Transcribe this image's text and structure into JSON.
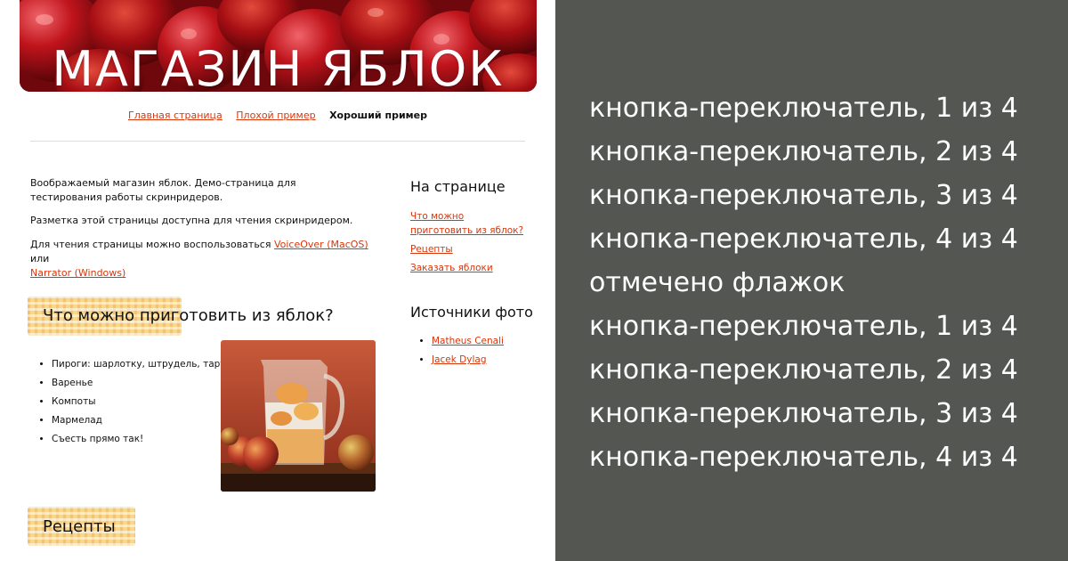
{
  "hero": {
    "title": "МАГАЗИН ЯБЛОК"
  },
  "nav": {
    "home": "Главная страница",
    "bad": "Плохой пример",
    "good": "Хороший пример"
  },
  "intro": {
    "p1": "Воображаемый магазин яблок. Демо-страница для тестирования работы скринридеров.",
    "p2": "Разметка этой страницы доступна для чтения скринридером.",
    "p3_before": "Для чтения страницы можно воспользоваться ",
    "voiceover": "VoiceOver (MacOS)",
    "p3_mid": " или",
    "narrator": "Narrator (Windows)"
  },
  "section1": {
    "heading": "Что можно приготовить из яблок?",
    "items": [
      "Пироги: шарлотку, штрудель, тарт",
      "Варенье",
      "Компоты",
      "Мармелад",
      "Съесть прямо так!"
    ]
  },
  "section2": {
    "heading": "Рецепты"
  },
  "aside": {
    "on_page_title": "На странице",
    "links": [
      "Что можно приготовить из яблок?",
      "Рецепты",
      "Заказать яблоки"
    ],
    "sources_title": "Источники фото",
    "sources": [
      "Matheus Cenali",
      "Jacek Dylag"
    ]
  },
  "screen_reader_output": [
    "кнопка-переключатель, 1 из 4",
    "кнопка-переключатель, 2 из 4",
    "кнопка-переключатель, 3 из 4",
    "кнопка-переключатель, 4 из 4",
    "отмечено флажок",
    "кнопка-переключатель, 1 из 4",
    "кнопка-переключатель, 2 из 4",
    "кнопка-переключатель, 3 из 4",
    "кнопка-переключатель, 4 из 4"
  ],
  "colors": {
    "link": "#d9360b",
    "panel": "#545651",
    "heading_highlight": "#f9d78a"
  }
}
